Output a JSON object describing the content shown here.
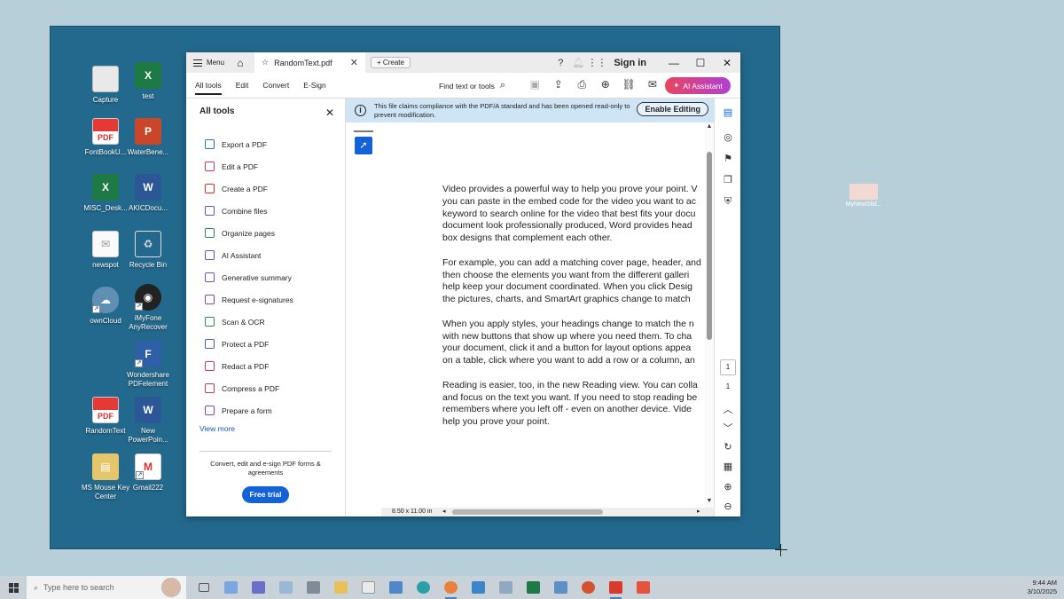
{
  "desktop": {
    "icons": [
      {
        "label": "Capture",
        "glyph": ""
      },
      {
        "label": "test",
        "glyph": "X"
      },
      {
        "label": "FontBookU...",
        "glyph": "PDF"
      },
      {
        "label": "WaterBene...",
        "glyph": "P"
      },
      {
        "label": "MISC_Desk...",
        "glyph": "X"
      },
      {
        "label": "AKICDocu...",
        "glyph": "W"
      },
      {
        "label": "newspot",
        "glyph": "✉"
      },
      {
        "label": "Recycle Bin",
        "glyph": "♻"
      },
      {
        "label": "ownCloud",
        "glyph": "☁"
      },
      {
        "label": "iMyFone AnyRecover",
        "glyph": "◉"
      },
      {
        "label": "Wondershare PDFelement",
        "glyph": "F"
      },
      {
        "label": "RandomText",
        "glyph": "PDF"
      },
      {
        "label": "New PowerPoin...",
        "glyph": "W"
      },
      {
        "label": "MS Mouse Key Center",
        "glyph": "▤"
      },
      {
        "label": "Gmail222",
        "glyph": "M"
      }
    ],
    "remote_icon_label": "MyNewSlid..."
  },
  "app": {
    "menu_label": "Menu",
    "tab_title": "RandomText.pdf",
    "create_label": "Create",
    "sign_in": "Sign in",
    "toolbar_tabs": [
      "All tools",
      "Edit",
      "Convert",
      "E-Sign"
    ],
    "find_label": "Find text or tools",
    "ai_button": "AI Assistant",
    "panel_title": "All tools",
    "tools": [
      "Export a PDF",
      "Edit a PDF",
      "Create a PDF",
      "Combine files",
      "Organize pages",
      "AI Assistant",
      "Generative summary",
      "Request e-signatures",
      "Scan & OCR",
      "Protect a PDF",
      "Redact a PDF",
      "Compress a PDF",
      "Prepare a form"
    ],
    "view_more": "View more",
    "promo_text": "Convert, edit and e-sign PDF forms & agreements",
    "free_trial": "Free trial",
    "notice_text": "This file claims compliance with the PDF/A standard and has been opened read-only to prevent modification.",
    "enable_editing": "Enable Editing",
    "page_size": "8.50 x 11.00 in",
    "page_current": "1",
    "page_total": "1",
    "document_lines": [
      [
        "Video provides a powerful way to help you prove your point. V",
        "you can paste in the embed code for the video you want to ac",
        "keyword to search online for the video that best fits your docu",
        "document look professionally produced, Word provides head",
        "box designs that complement each other."
      ],
      [
        "For example, you can add a matching cover page, header, and",
        "then choose the elements you want from the different galleri",
        "help keep your document coordinated. When you click Desig",
        "the pictures, charts, and SmartArt graphics change to match"
      ],
      [
        "When you apply styles, your headings change to match the n",
        "with new buttons that show up where you need them. To cha",
        "your document, click it and a button for layout options appea",
        "on a table, click where you want to add a row or a column, an"
      ],
      [
        "Reading is easier, too, in the new Reading view. You can colla",
        "and focus on the text you want. If you need to stop reading be",
        "remembers where you left off - even on another device. Vide",
        "help you prove your point."
      ]
    ]
  },
  "taskbar": {
    "search_placeholder": "Type here to search",
    "time": "9:44 AM",
    "date": "3/10/2025"
  }
}
